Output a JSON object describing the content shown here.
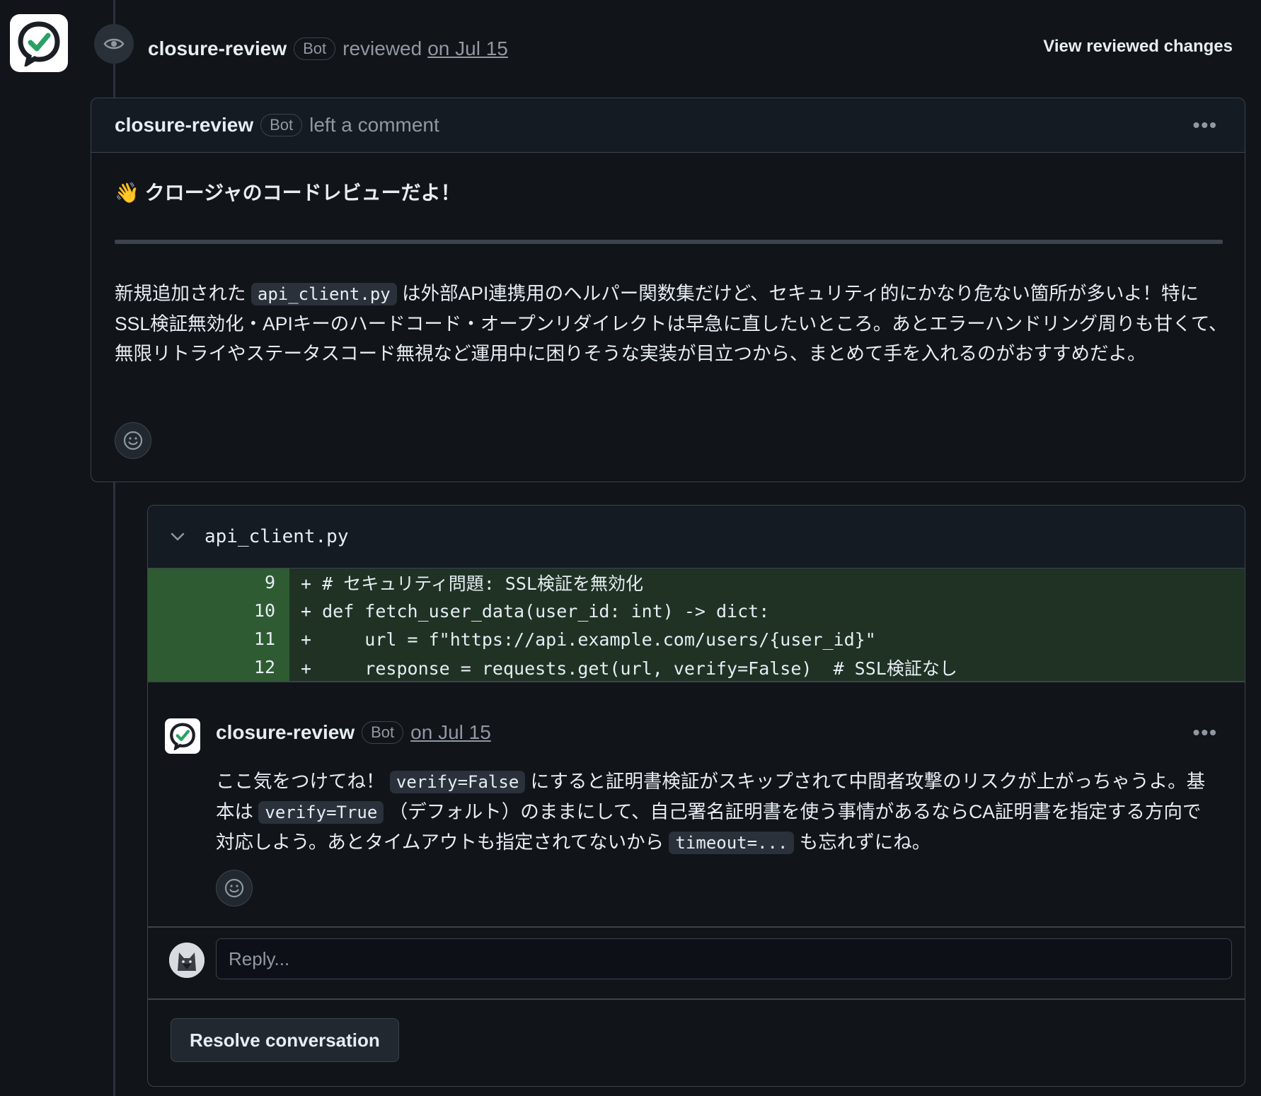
{
  "timeline": {
    "reviewer": "closure-review",
    "bot_badge": "Bot",
    "action": "reviewed",
    "date": "on Jul 15",
    "view_changes": "View reviewed changes"
  },
  "review": {
    "author": "closure-review",
    "bot_badge": "Bot",
    "action": "left a comment",
    "title": "👋 クロージャのコードレビューだよ！",
    "body_part1": "新規追加された",
    "body_code": "api_client.py",
    "body_part2": "は外部API連携用のヘルパー関数集だけど、セキュリティ的にかなり危ない箇所が多いよ！特に SSL検証無効化・APIキーのハードコード・オープンリダイレクトは早急に直したいところ。あとエラーハンドリング周りも甘くて、無限リトライやステータスコード無視など運用中に困りそうな実装が目立つから、まとめて手を入れるのがおすすめだよ。"
  },
  "thread": {
    "file_name": "api_client.py",
    "diff_lines": [
      {
        "num": "9",
        "code": "+ # セキュリティ問題: SSL検証を無効化"
      },
      {
        "num": "10",
        "code": "+ def fetch_user_data(user_id: int) -> dict:"
      },
      {
        "num": "11",
        "code": "+     url = f\"https://api.example.com/users/{user_id}\""
      },
      {
        "num": "12",
        "code": "+     response = requests.get(url, verify=False)  # SSL検証なし"
      }
    ],
    "comment": {
      "author": "closure-review",
      "bot_badge": "Bot",
      "date": "on Jul 15",
      "text1": "ここ気をつけてね！",
      "code1": "verify=False",
      "text2": "にすると証明書検証がスキップされて中間者攻撃のリスクが上がっちゃうよ。基本は",
      "code2": "verify=True",
      "text3": "（デフォルト）のままにして、自己署名証明書を使う事情があるならCA証明書を指定する方向で対応しよう。あとタイムアウトも指定されてないから",
      "code3": "timeout=...",
      "text4": "も忘れずにね。"
    },
    "reply_placeholder": "Reply...",
    "resolve_label": "Resolve conversation"
  }
}
